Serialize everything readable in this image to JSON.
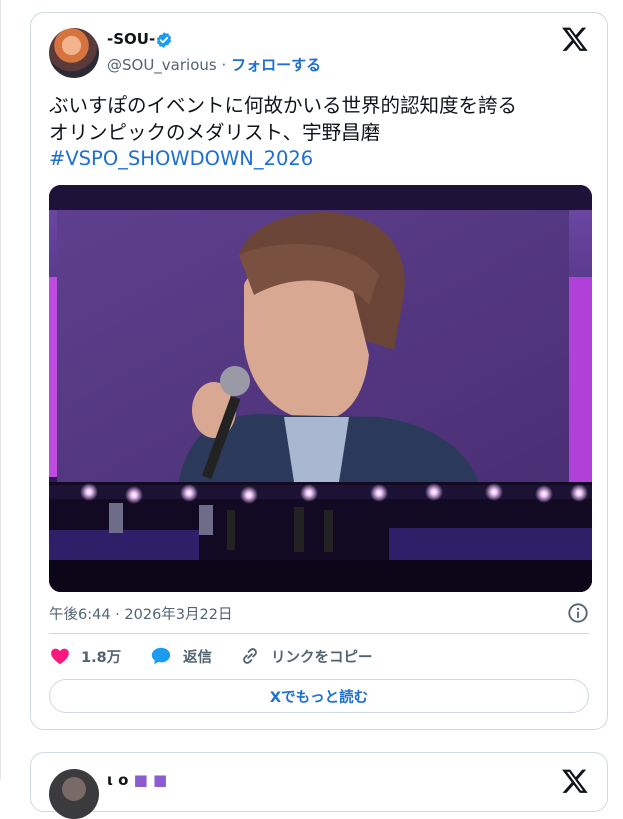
{
  "tweet": {
    "author_name": "-SOU-",
    "handle": "@SOU_various",
    "separator": "·",
    "follow_label": "フォローする",
    "text_line1": "ぶいすぽのイベントに何故かいる世界的認知度を誇る",
    "text_line2": "オリンピックのメダリスト、宇野昌磨",
    "hashtag": "#VSPO_SHOWDOWN_2026",
    "timestamp": "午後6:44 · 2026年3月22日",
    "likes": "1.8万",
    "reply_label": "返信",
    "copy_link_label": "リンクをコピー",
    "read_more_label": "Xでもっと読む"
  },
  "next_tweet": {
    "author_name_partial": "ι ο"
  },
  "colors": {
    "link_blue": "#1d6fd0",
    "like_pink": "#f91880",
    "verified_blue": "#1d9bf0",
    "muted_text": "#536471",
    "border": "#cfd9de"
  },
  "icons": {
    "brand": "x-logo-icon",
    "verified": "verified-badge-icon",
    "info": "info-icon",
    "like": "heart-icon",
    "reply": "reply-bubble-icon",
    "link": "link-icon"
  }
}
